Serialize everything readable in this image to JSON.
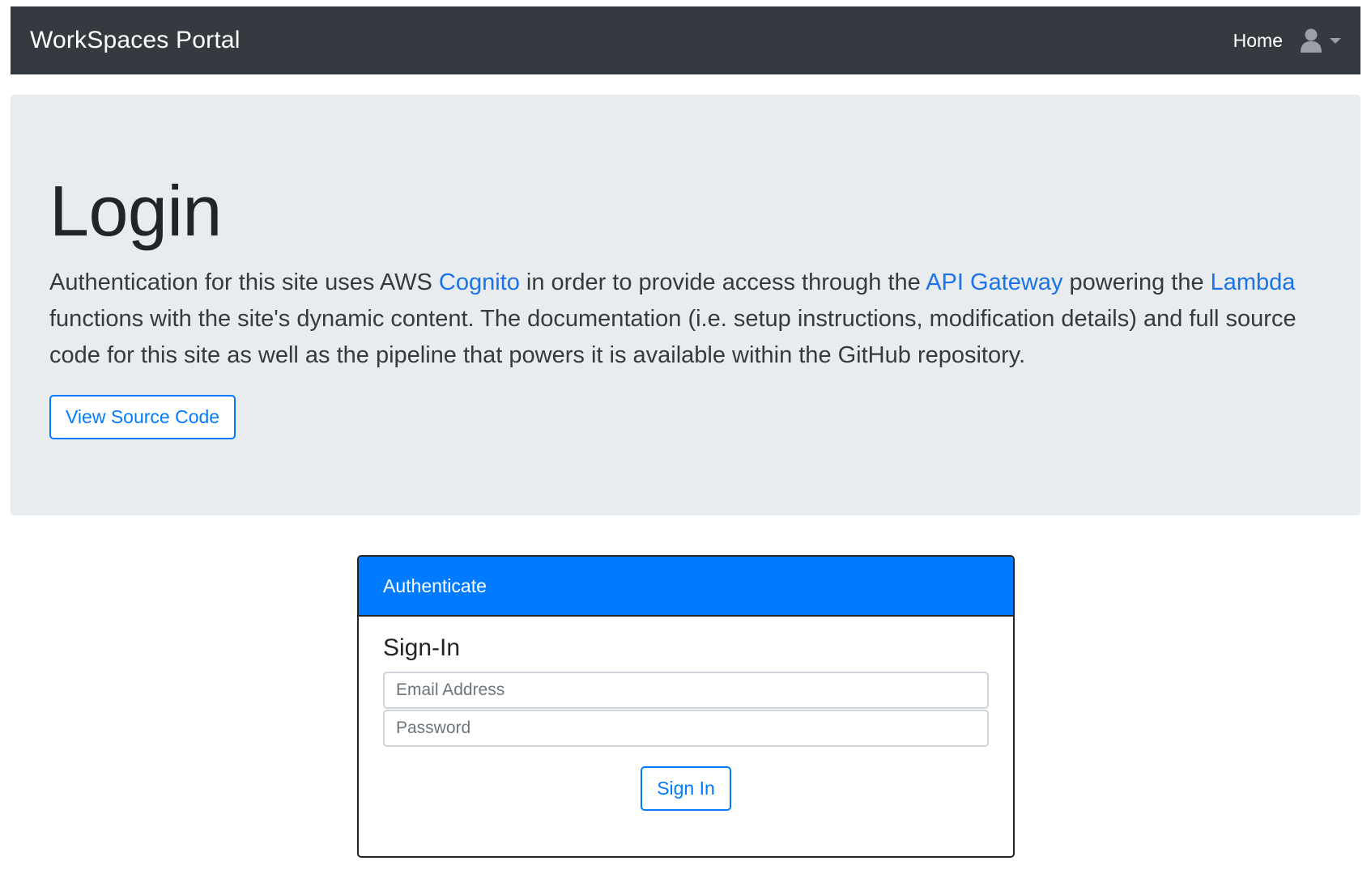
{
  "navbar": {
    "brand": "WorkSpaces Portal",
    "home_label": "Home",
    "user_icon": "user-icon",
    "dropdown_icon": "chevron-down-icon",
    "background": "#343a40"
  },
  "jumbotron": {
    "title": "Login",
    "lead_part1": "Authentication for this site uses AWS ",
    "link_cognito": "Cognito",
    "lead_part2": " in order to provide access through the ",
    "link_api_gateway": "API Gateway",
    "lead_part3": " powering the ",
    "link_lambda": "Lambda",
    "lead_part4": " functions with the site's dynamic content. The documentation (i.e. setup instructions, modification details) and full source code for this site as well as the pipeline that powers it is available within the GitHub repository.",
    "button_label": "View Source Code",
    "background": "#e9ecef"
  },
  "auth": {
    "header": "Authenticate",
    "title": "Sign-In",
    "email_placeholder": "Email Address",
    "email_value": "",
    "password_placeholder": "Password",
    "password_value": "",
    "signin_label": "Sign In",
    "accent": "#007bff"
  }
}
